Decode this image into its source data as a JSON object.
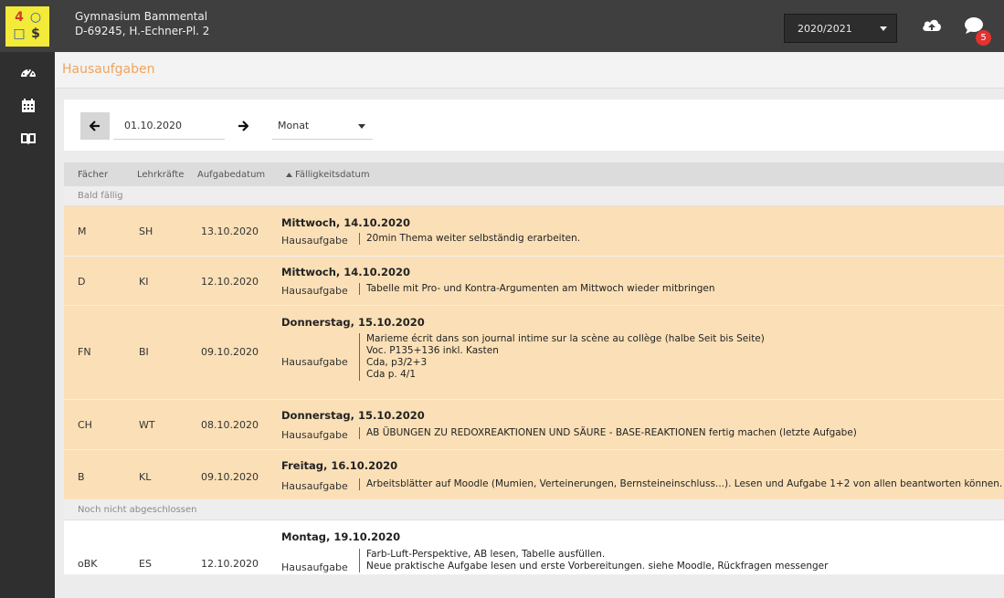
{
  "header": {
    "school_name": "Gymnasium Bammental",
    "school_address": "D-69245, H.-Echner-Pl. 2",
    "year": "2020/2021",
    "message_count": "5",
    "logo_glyphs": [
      "4",
      "○",
      "□",
      "$"
    ]
  },
  "page": {
    "title": "Hausaufgaben"
  },
  "filter": {
    "date": "01.10.2020",
    "period": "Monat"
  },
  "table": {
    "columns": {
      "subject": "Fächer",
      "teacher": "Lehrkräfte",
      "assigned": "Aufgabedatum",
      "due": "Fälligkeitsdatum"
    },
    "section_due_soon": "Bald fällig",
    "section_open": "Noch nicht abgeschlossen",
    "hw_label": "Hausaufgabe",
    "rows": [
      {
        "subject": "M",
        "teacher": "SH",
        "assigned": "13.10.2020",
        "due": "Mittwoch, 14.10.2020",
        "lines": [
          "20min Thema weiter selbständig erarbeiten."
        ]
      },
      {
        "subject": "D",
        "teacher": "KI",
        "assigned": "12.10.2020",
        "due": "Mittwoch, 14.10.2020",
        "lines": [
          "Tabelle mit Pro- und Kontra-Argumenten am Mittwoch wieder mitbringen"
        ]
      },
      {
        "subject": "FN",
        "teacher": "BI",
        "assigned": "09.10.2020",
        "due": "Donnerstag, 15.10.2020",
        "lines": [
          "Marieme écrit dans son journal intime sur la scène au collège (halbe Seit bis Seite)",
          "Voc. P135+136 inkl. Kasten",
          "Cda, p3/2+3",
          "Cda p. 4/1"
        ]
      },
      {
        "subject": "CH",
        "teacher": "WT",
        "assigned": "08.10.2020",
        "due": "Donnerstag, 15.10.2020",
        "lines": [
          "AB ÜBUNGEN ZU REDOXREAKTIONEN UND SÄURE - BASE-REAKTIONEN fertig machen (letzte Aufgabe)"
        ]
      },
      {
        "subject": "B",
        "teacher": "KL",
        "assigned": "09.10.2020",
        "due": "Freitag, 16.10.2020",
        "lines": [
          "Arbeitsblätter auf Moodle (Mumien, Verteinerungen, Bernsteineinschluss...). Lesen und Aufgabe 1+2 von allen beantworten können."
        ]
      },
      {
        "subject": "oBK",
        "teacher": "ES",
        "assigned": "12.10.2020",
        "due": "Montag, 19.10.2020",
        "lines": [
          "Farb-Luft-Perspektive, AB lesen, Tabelle ausfüllen.",
          "Neue praktische Aufgabe lesen und erste Vorbereitungen. siehe Moodle, Rückfragen messenger"
        ]
      }
    ]
  },
  "colors": {
    "accent": "#f0a45d",
    "due_row": "#fbe0b7",
    "topbar": "#3f3f3f",
    "sidebar": "#2f2f2f",
    "badge": "#e3322f"
  }
}
